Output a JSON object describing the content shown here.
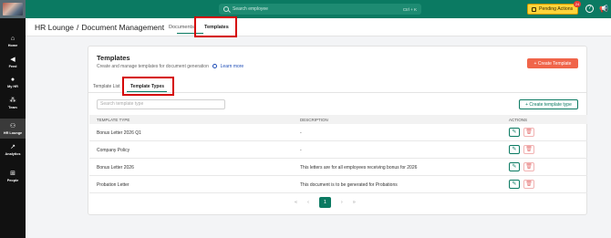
{
  "topbar": {
    "search_placeholder": "Search employee",
    "search_shortcut": "Ctrl + K",
    "pending_label": "Pending Actions",
    "pending_count": "24",
    "help_icon": "help-circle-icon",
    "announce_icon": "megaphone-icon"
  },
  "sidebar": {
    "items": [
      {
        "label": "Home",
        "icon": "home-icon",
        "glyph": "⌂"
      },
      {
        "label": "Feed",
        "icon": "megaphone-icon",
        "glyph": "◀"
      },
      {
        "label": "My HR",
        "icon": "person-icon",
        "glyph": "●"
      },
      {
        "label": "Team",
        "icon": "team-icon",
        "glyph": "⁂"
      },
      {
        "label": "HR Lounge",
        "icon": "people-settings-icon",
        "glyph": "⚇"
      },
      {
        "label": "Analytics",
        "icon": "chart-icon",
        "glyph": "↗"
      },
      {
        "label": "People",
        "icon": "org-chart-icon",
        "glyph": "⊞"
      }
    ]
  },
  "header": {
    "crumb_root": "HR Lounge",
    "crumb_sep": "/",
    "crumb_current": "Document Management",
    "tab_documents": "Documents",
    "tab_templates": "Templates"
  },
  "card": {
    "title": "Templates",
    "subtitle": "Create and manage templates for document generation",
    "learn_more": "Learn more",
    "create_button": "+ Create Template",
    "tab_list": "Template List",
    "tab_types": "Template Types",
    "search_placeholder": "Search template type",
    "create_type_button": "+ Create template type"
  },
  "table": {
    "headers": {
      "type": "Template Type",
      "description": "Description",
      "actions": "Actions"
    },
    "rows": [
      {
        "type": "Bonus Letter 2026 Q1",
        "description": "-"
      },
      {
        "type": "Company Policy",
        "description": "-"
      },
      {
        "type": "Bonus Letter 2026",
        "description": "This letters are for all employees receiving bonus for 2026"
      },
      {
        "type": "Probation Letter",
        "description": "This document is to be generated for Probations"
      }
    ]
  },
  "pagination": {
    "first": "«",
    "prev": "‹",
    "current": "1",
    "next": "›",
    "last": "»"
  },
  "colors": {
    "brand_green": "#0b7a62",
    "accent_orange": "#f0654a",
    "pending_yellow": "#fdd43b",
    "highlight_red": "#d50000"
  }
}
